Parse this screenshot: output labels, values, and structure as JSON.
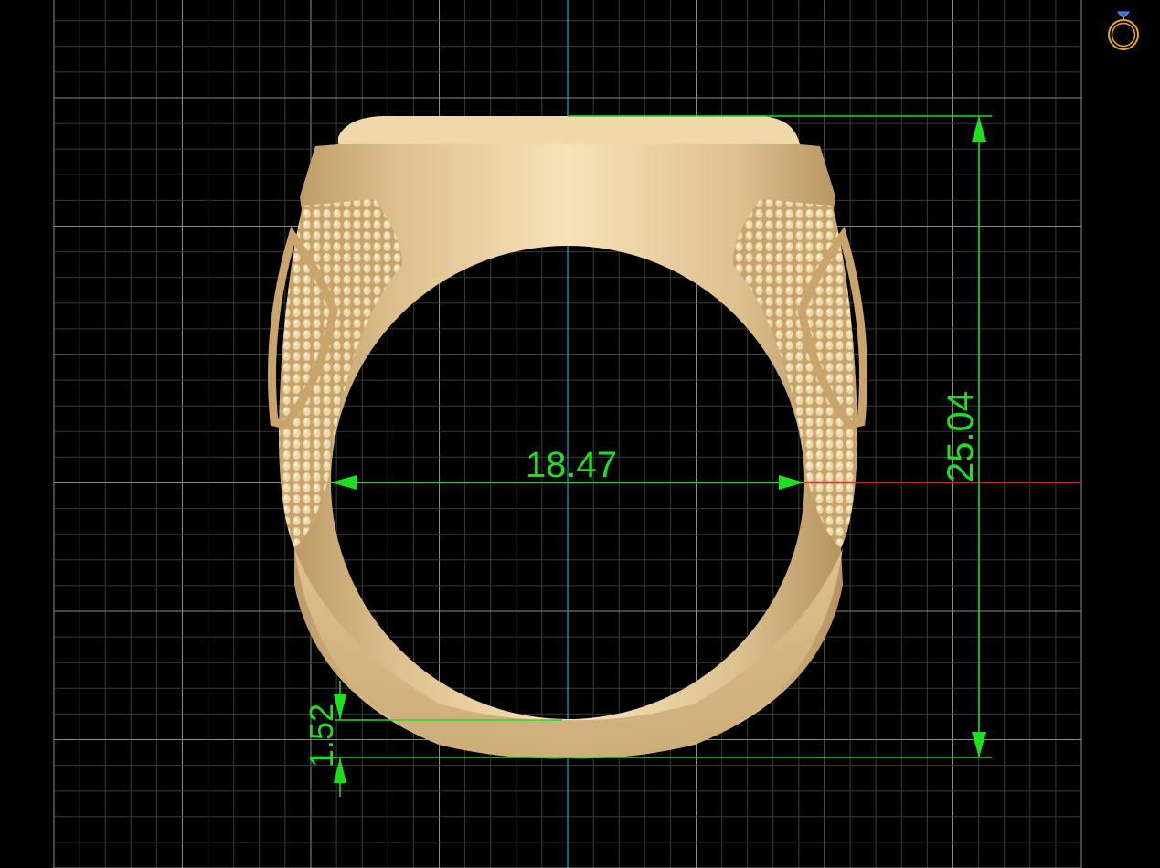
{
  "viewport": {
    "background": "#000000",
    "grid_minor_color": "#3a3a3a",
    "grid_major_color": "#8a8a8a",
    "axis_x_color": "#d01010",
    "axis_y_color": "#00b0c8",
    "dimension_color": "#1fe01f",
    "ring_color": "#e6cc9c"
  },
  "view_cube": {
    "icon": "ring-icon"
  },
  "dimensions": {
    "inner_diameter": "18.47",
    "total_height": "25.04",
    "band_thickness": "1.52"
  }
}
